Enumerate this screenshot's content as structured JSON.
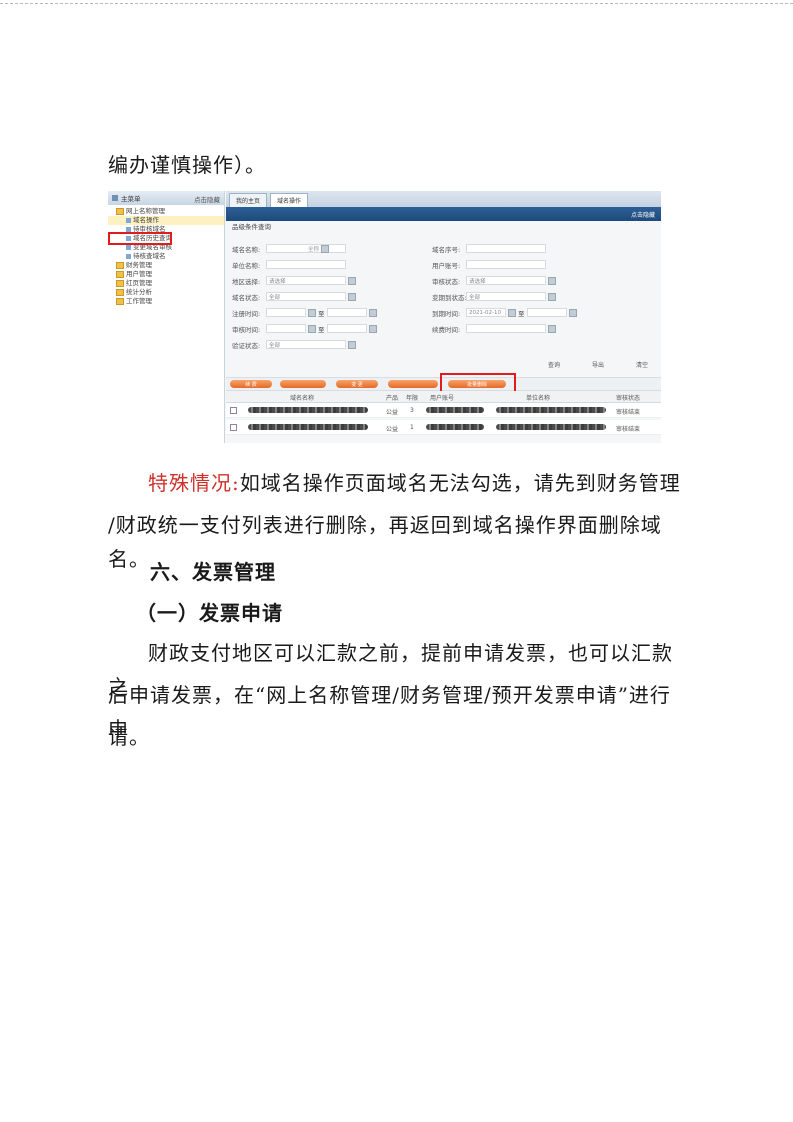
{
  "paragraphs": {
    "p1": "编办谨慎操作）。",
    "special_label": "特殊情况:",
    "special_line1": "如域名操作页面域名无法勾选，请先到财务管理",
    "special_line2": "/财政统一支付列表进行删除，再返回到域名操作界面删除域名。",
    "invoice_line1": "财政支付地区可以汇款之前，提前申请发票，也可以汇款之",
    "invoice_line2": "后申请发票，在“网上名称管理/财务管理/预开发票申请”进行申",
    "invoice_line3": "请。"
  },
  "headings": {
    "section6": "六、发票管理",
    "sub1": "（一）发票申请"
  },
  "screenshot": {
    "sidebar": {
      "title": "主菜单",
      "header_right": "点击隐藏",
      "tree": [
        {
          "label": "网上名称管理",
          "type": "folder",
          "level": 0
        },
        {
          "label": "域名操作",
          "type": "leaf",
          "level": 1,
          "selected": true
        },
        {
          "label": "待审核域名",
          "type": "leaf",
          "level": 1
        },
        {
          "label": "域名历史查询",
          "type": "leaf",
          "level": 1
        },
        {
          "label": "变更域名审核",
          "type": "leaf",
          "level": 1
        },
        {
          "label": "待核查域名",
          "type": "leaf",
          "level": 1
        },
        {
          "label": "财务管理",
          "type": "folder",
          "level": 0
        },
        {
          "label": "用户管理",
          "type": "folder",
          "level": 0
        },
        {
          "label": "红页管理",
          "type": "folder",
          "level": 0
        },
        {
          "label": "统计分析",
          "type": "folder",
          "level": 0
        },
        {
          "label": "工作管理",
          "type": "folder",
          "level": 0
        }
      ]
    },
    "tabs": [
      {
        "label": "我的主页",
        "active": false
      },
      {
        "label": "域名操作",
        "active": true
      }
    ],
    "bluebar_right": "点击隐藏",
    "form_title": "品级条件查询",
    "fields": {
      "domain_name": {
        "label": "域名名称:",
        "value": "",
        "hint": "全称"
      },
      "domain_no": {
        "label": "域名序号:",
        "value": ""
      },
      "org_name": {
        "label": "单位名称:",
        "value": ""
      },
      "user_account": {
        "label": "用户账号:",
        "value": ""
      },
      "region": {
        "label": "地区选择:",
        "value": "请选择"
      },
      "review_status": {
        "label": "审核状态:",
        "value": "请选择"
      },
      "domain_status": {
        "label": "域名状态:",
        "value": "全部"
      },
      "expire_status": {
        "label": "变期到状态:",
        "value": "全部"
      },
      "reg_time": {
        "label": "注册时间:",
        "value": "",
        "sep": "至"
      },
      "due_time": {
        "label": "到期时间:",
        "value": "2021-02-10",
        "sep": "至"
      },
      "review_time": {
        "label": "审核时间:",
        "value": "",
        "sep": "至"
      },
      "renew_time": {
        "label": "续费时间:",
        "value": ""
      },
      "verify_status": {
        "label": "验证状态:",
        "value": "全部"
      }
    },
    "query_buttons": [
      "查询",
      "导出",
      "清空"
    ],
    "action_buttons": [
      "续  费",
      "",
      "变  更",
      "",
      "批量删除"
    ],
    "grid": {
      "columns": [
        "域名名称",
        "产品",
        "年限",
        "用户账号",
        "单位名称",
        "审核状态"
      ],
      "rows": [
        {
          "product": "公益",
          "years": "3",
          "status": "审核结束"
        },
        {
          "product": "公益",
          "years": "1",
          "status": "审核结束"
        }
      ]
    }
  }
}
